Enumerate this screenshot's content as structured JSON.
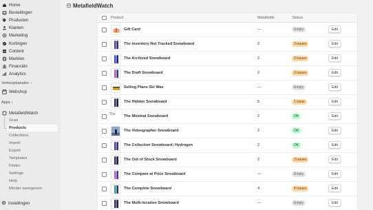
{
  "sidebar": {
    "items": [
      {
        "label": "Home",
        "icon": "home-icon"
      },
      {
        "label": "Bestellingen",
        "icon": "inbox-icon"
      },
      {
        "label": "Producten",
        "icon": "tag-icon"
      },
      {
        "label": "Klanten",
        "icon": "person-icon"
      },
      {
        "label": "Marketing",
        "icon": "target-icon"
      },
      {
        "label": "Kortingen",
        "icon": "discount-icon"
      },
      {
        "label": "Content",
        "icon": "content-icon"
      },
      {
        "label": "Markten",
        "icon": "globe-icon"
      },
      {
        "label": "Financiën",
        "icon": "bank-icon"
      },
      {
        "label": "Analytics",
        "icon": "chart-icon"
      }
    ],
    "sales_channels_label": "Verkoopkanalen",
    "webshop_label": "Webshop",
    "apps_label": "Apps",
    "app_name": "MetafieldWatch",
    "app_subitems": [
      "Scan",
      "Products",
      "Collections",
      "Import",
      "Export",
      "Templates",
      "Finder",
      "Settings",
      "Help",
      "Minder weergeven"
    ],
    "active_subitem": "Products",
    "settings_label": "Instellingen"
  },
  "page": {
    "title": "MetafieldWatch"
  },
  "table": {
    "headers": {
      "product": "Product",
      "metafields": "Metafields",
      "status": "Status"
    },
    "edit_label": "Edit",
    "rows": [
      {
        "name": "Gift Card",
        "metafields": "—",
        "status": "Empty",
        "status_type": "empty",
        "thumb": "giftcard"
      },
      {
        "name": "The Inventory Not Tracked Snowboard",
        "metafields": "2",
        "status": "3 issues",
        "status_type": "issues",
        "thumb": "board-purple"
      },
      {
        "name": "The Archived Snowboard",
        "metafields": "2",
        "status": "3 issues",
        "status_type": "issues",
        "thumb": "board-blue"
      },
      {
        "name": "The Draft Snowboard",
        "metafields": "2",
        "status": "3 issues",
        "status_type": "issues",
        "thumb": "board-mix"
      },
      {
        "name": "Selling Plans Ski Wax",
        "metafields": "—",
        "status": "Empty",
        "status_type": "empty",
        "thumb": "wax"
      },
      {
        "name": "The Hidden Snowboard",
        "metafields": "5",
        "status": "1 issue",
        "status_type": "issues",
        "thumb": "board-dark"
      },
      {
        "name": "The Minimal Snowboard",
        "metafields": "2",
        "status": "OK",
        "status_type": "ok",
        "thumb": "broken",
        "thumb_alt": "The"
      },
      {
        "name": "The Videographer Snowboard",
        "metafields": "2",
        "status": "OK",
        "status_type": "ok",
        "thumb": "photo"
      },
      {
        "name": "The Collection Snowboard: Hydrogen",
        "metafields": "2",
        "status": "OK",
        "status_type": "ok",
        "thumb": "board-purple"
      },
      {
        "name": "The Out of Stock Snowboard",
        "metafields": "2",
        "status": "3 issues",
        "status_type": "issues",
        "thumb": "board-dark"
      },
      {
        "name": "The Compare at Price Snowboard",
        "metafields": "—",
        "status": "Empty",
        "status_type": "empty",
        "thumb": "board-mix"
      },
      {
        "name": "The Complete Snowboard",
        "metafields": "4",
        "status": "4 issues",
        "status_type": "issues",
        "thumb": "board-teal"
      },
      {
        "name": "The Multi-location Snowboard",
        "metafields": "—",
        "status": "Empty",
        "status_type": "empty",
        "thumb": "board-dark"
      }
    ]
  }
}
